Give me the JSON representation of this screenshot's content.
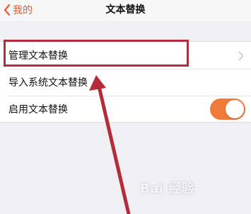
{
  "nav": {
    "back_label": "我的",
    "title": "文本替换"
  },
  "settings": {
    "rows": [
      {
        "label": "管理文本替换"
      },
      {
        "label": "导入系统文本替换"
      },
      {
        "label": "启用文本替换",
        "toggle_on": true
      }
    ]
  },
  "colors": {
    "accent": "#f0572a",
    "toggle_on": "#f07a37",
    "annotation": "#b42b3a"
  },
  "watermark": {
    "text": "Bai 经验"
  }
}
